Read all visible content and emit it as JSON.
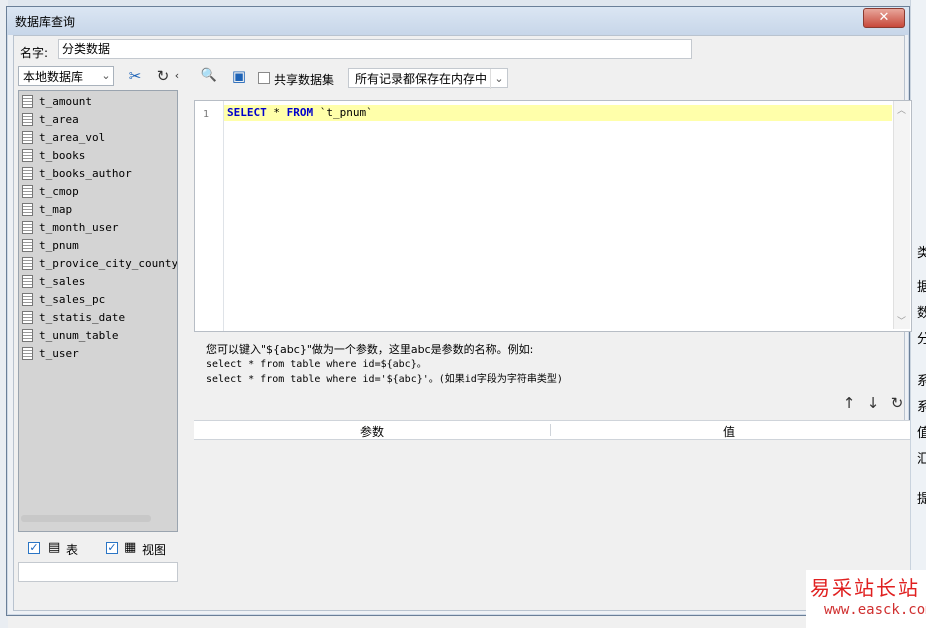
{
  "dialog": {
    "title": "数据库查询",
    "close_icon": "close-icon"
  },
  "name_field": {
    "label": "名字:",
    "value": "分类数据"
  },
  "left_panel": {
    "datasource_select": "本地数据库",
    "icons": [
      "refresh-connections-icon",
      "refresh-icon"
    ],
    "tables": [
      "t_amount",
      "t_area",
      "t_area_vol",
      "t_books",
      "t_books_author",
      "t_cmop",
      "t_map",
      "t_month_user",
      "t_pnum",
      "t_provice_city_county_s",
      "t_sales",
      "t_sales_pc",
      "t_statis_date",
      "t_unum_table",
      "t_user"
    ],
    "show_table_checked": true,
    "show_table_label": "表",
    "show_view_checked": true,
    "show_view_label": "视图"
  },
  "toolbar": {
    "share_dataset_label": "共享数据集",
    "share_dataset_checked": false,
    "memory_select": "所有记录都保存在内存中"
  },
  "editor": {
    "line_number": "1",
    "sql_select": "SELECT",
    "sql_star": " * ",
    "sql_from": "FROM",
    "sql_table": " `t_pnum`"
  },
  "hint": {
    "line1": "您可以键入\"${abc}\"做为一个参数，这里abc是参数的名称。例如:",
    "line2": "select * from table where id=${abc}。",
    "line3": "select * from table where id='${abc}'。(如果id字段为字符串类型)"
  },
  "param_table": {
    "headers": [
      "参数",
      "值"
    ]
  },
  "background": {
    "right_chars": [
      "类",
      "据",
      "数",
      "分",
      "系",
      "系",
      "值",
      "汇",
      "提"
    ]
  },
  "watermark": {
    "text_cn": "易采站长站",
    "text_url": "www.easck.com"
  }
}
